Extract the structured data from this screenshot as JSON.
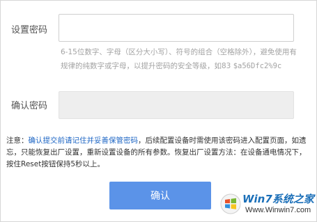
{
  "form": {
    "password_label": "设置密码",
    "password_value": "",
    "hint_prefix": "6-15位数字、字母（区分大小写）、符号的组合（空格除外），避免使用有规律的纯数字或字母，以提升密码的安全等级，如83",
    "hint_example": "$a56Dfc2%9c",
    "confirm_label": "确认密码",
    "confirm_value": ""
  },
  "notice": {
    "prefix": "注意：",
    "highlight": "确认提交前请记住并妥善保管密码",
    "body": "，后续配置设备时需使用该密码进入配置页面，如遗忘，只能恢复出厂设置，重新设置设备的所有参数。恢复出厂设置方法：在设备通电情况下，按住Reset按钮保持5秒以上。"
  },
  "confirm_button": {
    "label": "确认"
  },
  "watermark": {
    "title": "Win7系统之家",
    "url": "Www.Winwin7.com"
  },
  "colors": {
    "button": "#5b93e8",
    "link": "#1e66c4",
    "hint": "#a3a3a3",
    "watermark": "#1b6fb8"
  }
}
